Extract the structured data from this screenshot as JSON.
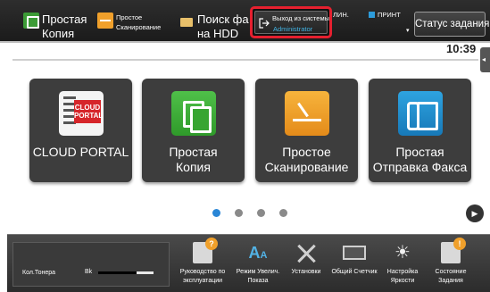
{
  "topbar": {
    "simple_copy": "Простая Копия",
    "simple_copy_line1": "Простая",
    "simple_copy_line2": "Копия",
    "simple_scan_line1": "Простое",
    "simple_scan_line2": "Сканирование",
    "hdd_line1": "Поиск фа",
    "hdd_line2": "на HDD",
    "logout_label": "Выход из системы",
    "logout_user": "Administrator",
    "status_line": "ЛИН.",
    "status_print": "ПРИНТ",
    "job_status": "Статус задания"
  },
  "main": {
    "clock": "10:39",
    "tiles": [
      {
        "label": "CLOUD PORTAL",
        "icon": "cloud-portal-icon"
      },
      {
        "label_line1": "Простая",
        "label_line2": "Копия",
        "icon": "copy-icon"
      },
      {
        "label_line1": "Простое",
        "label_line2": "Сканирование",
        "icon": "scan-icon"
      },
      {
        "label_line1": "Простая",
        "label_line2": "Отправка Факса",
        "icon": "fax-icon"
      }
    ],
    "cloud_badge_line1": "CLOUD",
    "cloud_badge_line2": "PORTAL",
    "pager": {
      "pages": 4,
      "current": 1
    }
  },
  "bottombar": {
    "toner_label": "Кол.Тонера",
    "toner_color": "Bk",
    "toner_level": 0.7,
    "items": [
      {
        "label_line1": "Руководство по",
        "label_line2": "эксплуатации",
        "icon": "manual-icon"
      },
      {
        "label_line1": "Режим Увелич.",
        "label_line2": "Показа",
        "icon": "zoom-display-icon"
      },
      {
        "label_line1": "Установки",
        "label_line2": "",
        "icon": "settings-icon"
      },
      {
        "label_line1": "Общий Счетчик",
        "label_line2": "",
        "icon": "counter-icon"
      },
      {
        "label_line1": "Настройка",
        "label_line2": "Яркости",
        "icon": "brightness-icon"
      },
      {
        "label_line1": "Состояние",
        "label_line2": "Задания",
        "icon": "job-status-icon"
      }
    ]
  },
  "colors": {
    "highlight": "#e5202f",
    "copy": "#3c9b36",
    "scan": "#f0a02b",
    "fax": "#2ea3e0",
    "pager_active": "#2a86d6"
  }
}
